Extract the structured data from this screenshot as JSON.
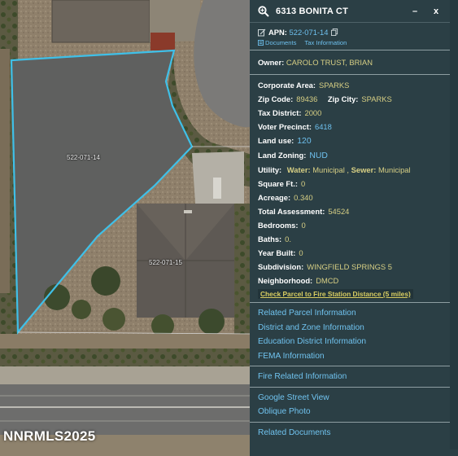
{
  "map": {
    "parcels": [
      {
        "id": "522-071-14"
      },
      {
        "id": "522-071-15"
      }
    ],
    "watermark": "NNRMLS2025",
    "highlight_color": "#3fc0e8"
  },
  "panel": {
    "title": "6313 BONITA CT",
    "minimize_label": "–",
    "close_label": "x",
    "apn": {
      "label": "APN:",
      "value": "522-071-14",
      "documents_label": "Documents",
      "tax_label": "Tax Information"
    },
    "owner": {
      "label": "Owner:",
      "value": "CAROLO TRUST, BRIAN"
    },
    "fields": {
      "corporate_area": {
        "label": "Corporate Area:",
        "value": "SPARKS"
      },
      "zip_code": {
        "label": "Zip Code:",
        "value": "89436"
      },
      "zip_city": {
        "label": "Zip City:",
        "value": "SPARKS"
      },
      "tax_district": {
        "label": "Tax District:",
        "value": "2000"
      },
      "voter_precinct": {
        "label": "Voter Precinct:",
        "value": "6418"
      },
      "land_use": {
        "label": "Land use:",
        "value": "120"
      },
      "land_zoning": {
        "label": "Land Zoning:",
        "value": "NUD"
      },
      "utility": {
        "label": "Utility:",
        "water_label": "Water:",
        "water_value": "Municipal ,",
        "sewer_label": "Sewer:",
        "sewer_value": "Municipal"
      },
      "square_ft": {
        "label": "Square Ft.:",
        "value": "0"
      },
      "acreage": {
        "label": "Acreage:",
        "value": "0.340"
      },
      "total_assessment": {
        "label": "Total Assessment:",
        "value": "54524"
      },
      "bedrooms": {
        "label": "Bedrooms:",
        "value": "0"
      },
      "baths": {
        "label": "Baths:",
        "value": "0."
      },
      "year_built": {
        "label": "Year Built:",
        "value": "0"
      },
      "subdivision": {
        "label": "Subdivision:",
        "value": "WINGFIELD SPRINGS 5"
      },
      "neighborhood": {
        "label": "Neighborhood:",
        "value": "DMCD"
      }
    },
    "fire_distance_link": "Check Parcel to Fire Station Distance (5 miles)",
    "sections": [
      [
        "Related Parcel Information",
        "District and Zone Information",
        "Education District Information",
        "FEMA Information"
      ],
      [
        "Fire Related Information"
      ],
      [
        "Google Street View",
        "Oblique Photo"
      ],
      [
        "Related Documents"
      ]
    ]
  }
}
